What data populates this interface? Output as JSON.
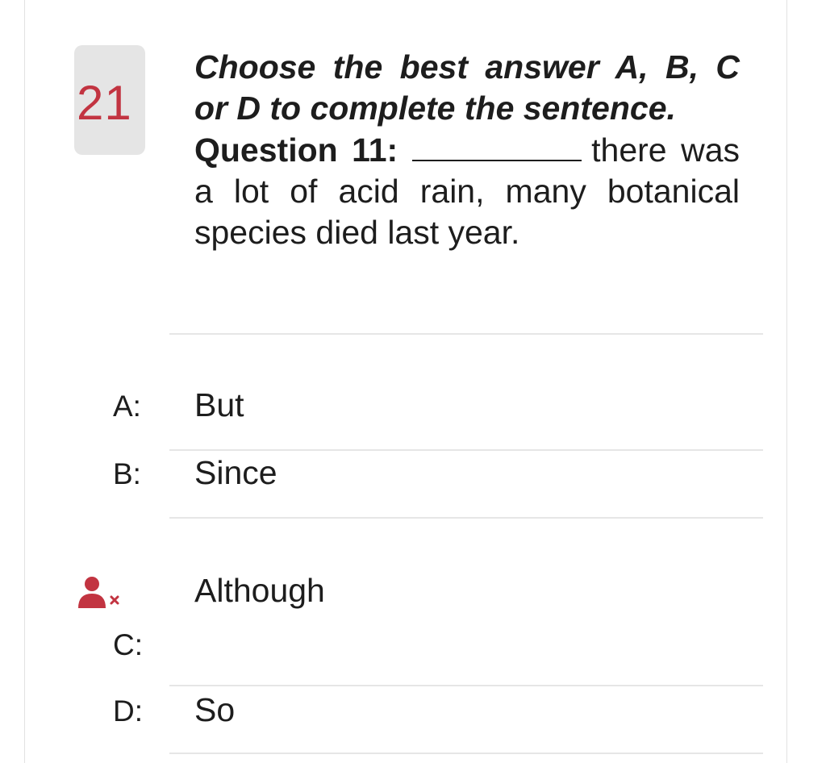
{
  "question": {
    "number": "21",
    "instruction_line1": "Choose the best answer A, B, C",
    "instruction_line2": "or D to complete the sentence.",
    "label": "Question 11:",
    "text_after_blank": "there was a lot of acid rain, many botanical species died last year."
  },
  "options": [
    {
      "letter": "A:",
      "text": "But"
    },
    {
      "letter": "B:",
      "text": "Since"
    },
    {
      "letter": "C:",
      "text": "Although",
      "marker": "user-wrong-icon"
    },
    {
      "letter": "D:",
      "text": "So"
    }
  ],
  "colors": {
    "accent": "#c23441",
    "badge_bg": "#e5e5e5",
    "text": "#1d1d1d",
    "divider": "#e6e6e6"
  }
}
